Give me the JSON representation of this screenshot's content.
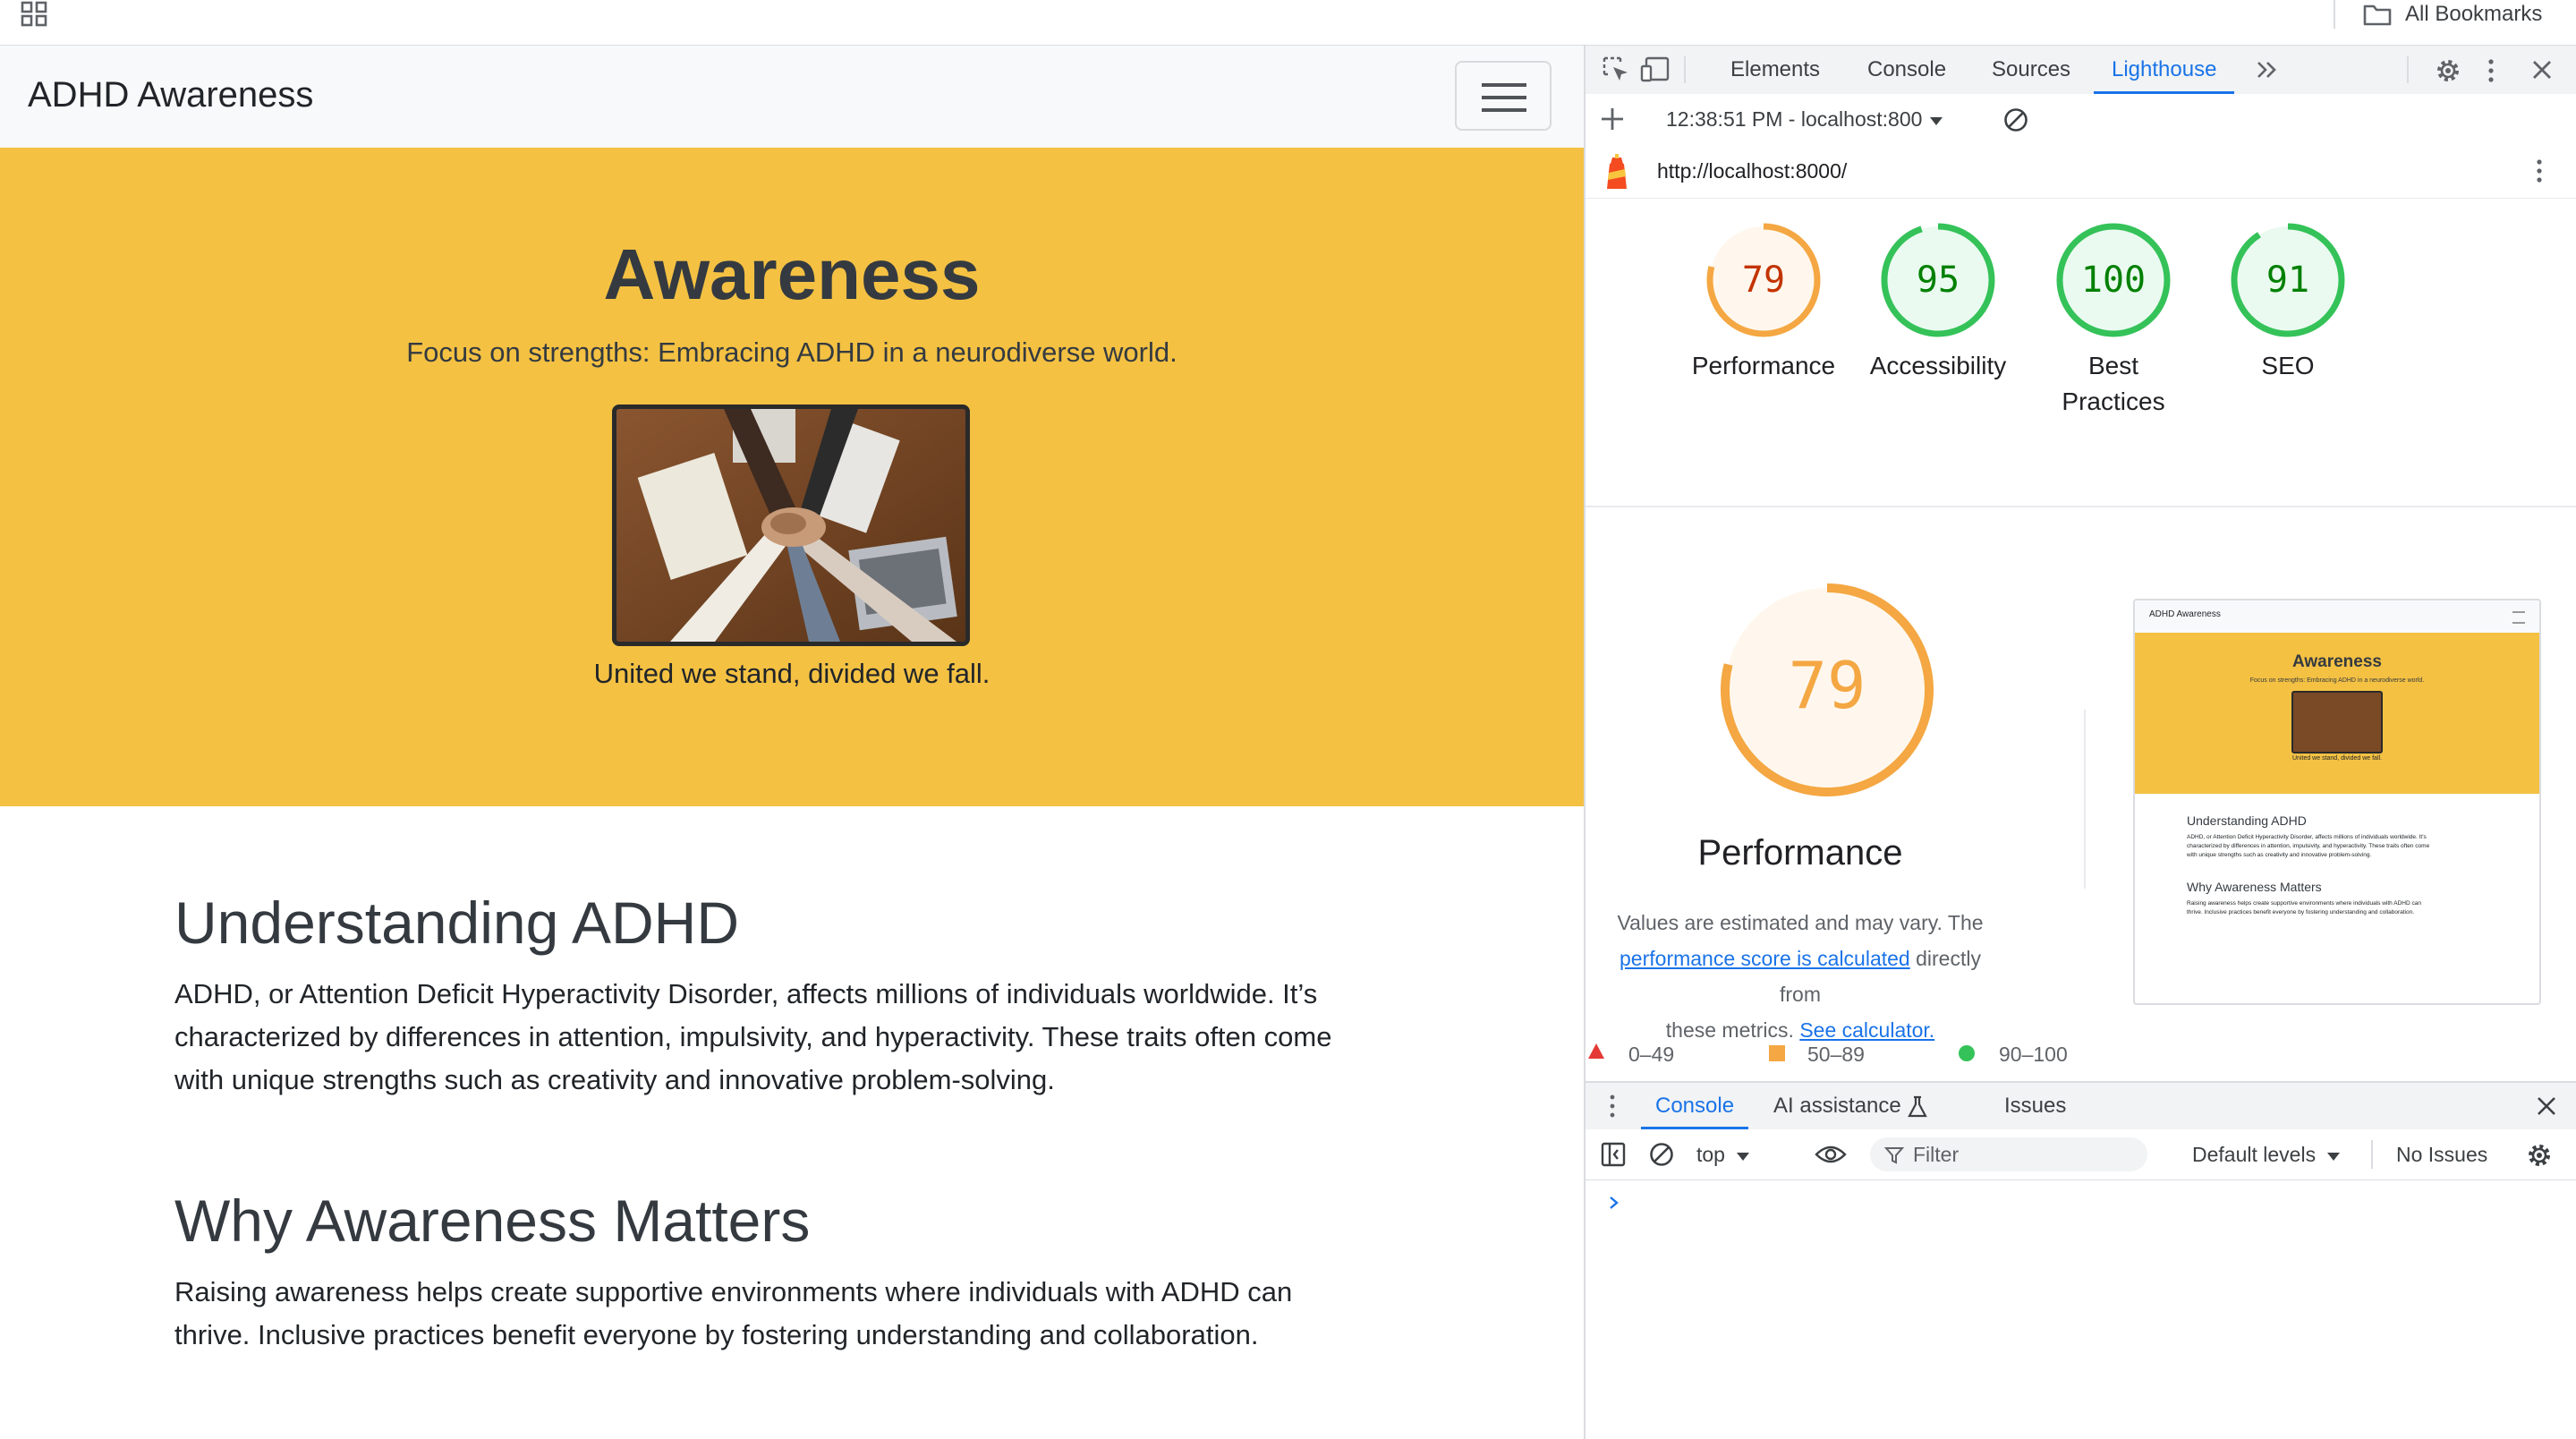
{
  "bookmarks_bar": {
    "all_bookmarks_label": "All Bookmarks"
  },
  "site": {
    "brand": "ADHD Awareness",
    "hero": {
      "title": "Awareness",
      "tagline": "Focus on strengths: Embracing ADHD in a neurodiverse world.",
      "caption": "United we stand, divided we fall."
    },
    "sections": [
      {
        "heading": "Understanding ADHD",
        "lines": [
          "ADHD, or Attention Deficit Hyperactivity Disorder, affects millions of individuals worldwide. It’s",
          "characterized by differences in attention, impulsivity, and hyperactivity. These traits often come",
          "with unique strengths such as creativity and innovative problem-solving."
        ]
      },
      {
        "heading": "Why Awareness Matters",
        "lines": [
          "Raising awareness helps create supportive environments where individuals with ADHD can",
          "thrive. Inclusive practices benefit everyone by fostering understanding and collaboration."
        ]
      }
    ]
  },
  "devtools": {
    "tabs": [
      "Elements",
      "Console",
      "Sources",
      "Lighthouse"
    ],
    "active_tab": "Lighthouse",
    "lighthouse": {
      "report_selector": "12:38:51 PM - localhost:800",
      "url": "http://localhost:8000/",
      "scores": [
        {
          "label": "Performance",
          "value": 79,
          "status": "average"
        },
        {
          "label": "Accessibility",
          "value": 95,
          "status": "pass"
        },
        {
          "label": "Best Practices",
          "label_lines": [
            "Best",
            "Practices"
          ],
          "value": 100,
          "status": "pass"
        },
        {
          "label": "SEO",
          "value": 91,
          "status": "pass"
        }
      ],
      "performance_detail": {
        "score": 79,
        "title": "Performance",
        "desc_1": "Values are estimated and may vary. The",
        "desc_link_1": "performance score is calculated",
        "desc_2": "directly from",
        "desc_3": "these metrics.",
        "desc_link_2": "See calculator."
      },
      "thumbnail": {
        "brand": "ADHD Awareness",
        "title": "Awareness",
        "tagline": "Focus on strengths: Embracing ADHD in a neurodiverse world.",
        "caption": "United we stand, divided we fall.",
        "h1": "Understanding ADHD",
        "p1": [
          "ADHD, or Attention Deficit Hyperactivity Disorder, affects millions of individuals worldwide. It's",
          "characterized by differences in attention, impulsivity, and hyperactivity. These traits often come",
          "with unique strengths such as creativity and innovative problem-solving."
        ],
        "h2": "Why Awareness Matters",
        "p2": [
          "Raising awareness helps create supportive environments where individuals with ADHD can",
          "thrive. Inclusive practices benefit everyone by fostering understanding and collaboration."
        ]
      },
      "legend": [
        {
          "range": "0–49",
          "color": "#e53935",
          "shape": "triangle"
        },
        {
          "range": "50–89",
          "color": "#f4a742",
          "shape": "square"
        },
        {
          "range": "90–100",
          "color": "#34c259",
          "shape": "circle"
        }
      ]
    },
    "drawer": {
      "tabs": [
        "Console",
        "AI assistance",
        "Issues"
      ],
      "active_tab": "Console",
      "context": "top",
      "filter_placeholder": "Filter",
      "levels": "Default levels",
      "issues": "No Issues"
    }
  },
  "colors": {
    "hero_bg": "#f4c143",
    "average": "#f4a742",
    "average_text": "#c33300",
    "pass": "#34c259",
    "pass_text": "#008000",
    "accent": "#1a73e8"
  }
}
